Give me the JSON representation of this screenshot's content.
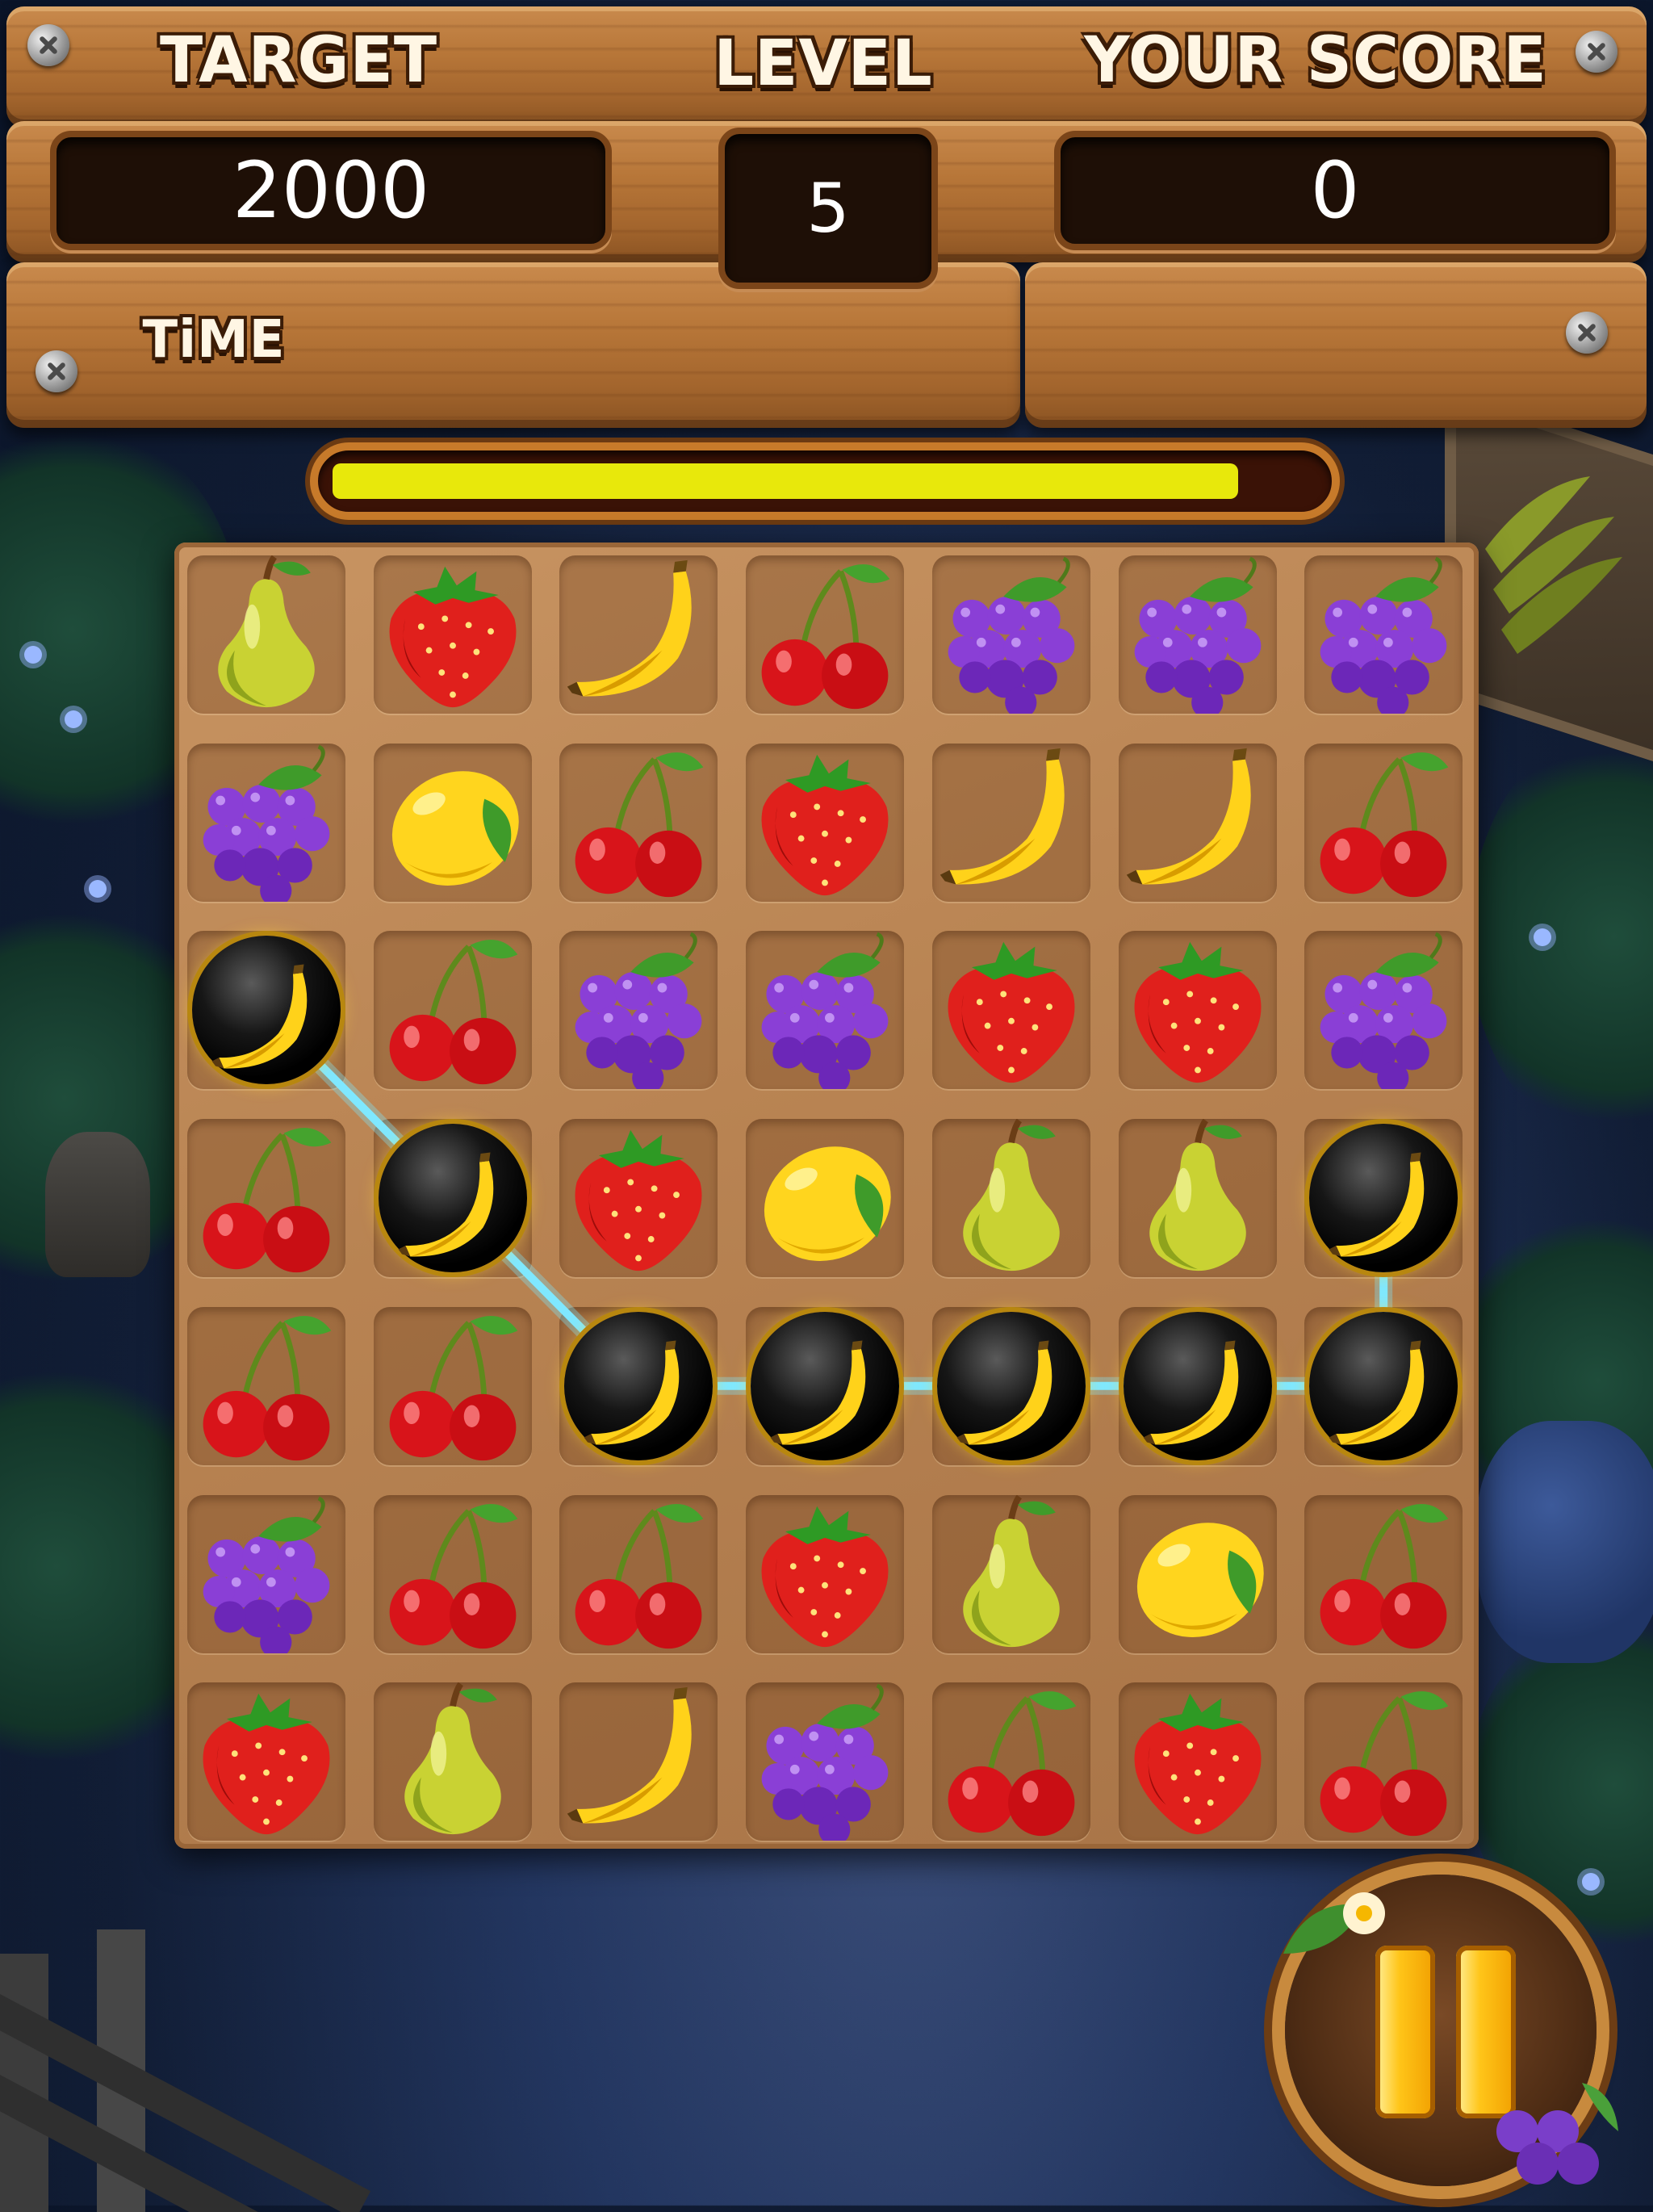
{
  "header": {
    "target_label": "TARGET",
    "target_value": "2000",
    "level_label": "LEVEL",
    "level_value": "5",
    "score_label": "YOUR SCORE",
    "score_value": "0",
    "time_label": "TiME"
  },
  "timer": {
    "fraction_remaining": 0.92,
    "fill_color": "#e8e80b"
  },
  "board": {
    "rows": 7,
    "cols": 7,
    "grid": [
      [
        "pear",
        "strawberry",
        "banana",
        "cherry",
        "grape",
        "grape",
        "grape"
      ],
      [
        "grape",
        "lemon",
        "cherry",
        "strawberry",
        "banana",
        "banana",
        "cherry"
      ],
      [
        "banana-orb",
        "cherry",
        "grape",
        "grape",
        "strawberry",
        "strawberry",
        "grape"
      ],
      [
        "cherry",
        "banana-orb",
        "strawberry",
        "lemon",
        "pear",
        "pear",
        "banana-orb"
      ],
      [
        "cherry",
        "cherry",
        "banana-orb",
        "banana-orb",
        "banana-orb",
        "banana-orb",
        "banana-orb"
      ],
      [
        "grape",
        "cherry",
        "cherry",
        "strawberry",
        "pear",
        "lemon",
        "cherry"
      ],
      [
        "strawberry",
        "pear",
        "banana",
        "grape",
        "cherry",
        "strawberry",
        "cherry"
      ]
    ],
    "selected_path": [
      [
        2,
        0
      ],
      [
        3,
        1
      ],
      [
        4,
        2
      ],
      [
        4,
        3
      ],
      [
        4,
        4
      ],
      [
        4,
        5
      ],
      [
        4,
        6
      ],
      [
        3,
        6
      ]
    ],
    "connector_color": "#7fe8ff"
  },
  "colors": {
    "wood": "#b77638",
    "value_box": "#1e0f06",
    "pause_gold": "#ffc519"
  },
  "icons": {
    "pause": "pause-icon"
  }
}
